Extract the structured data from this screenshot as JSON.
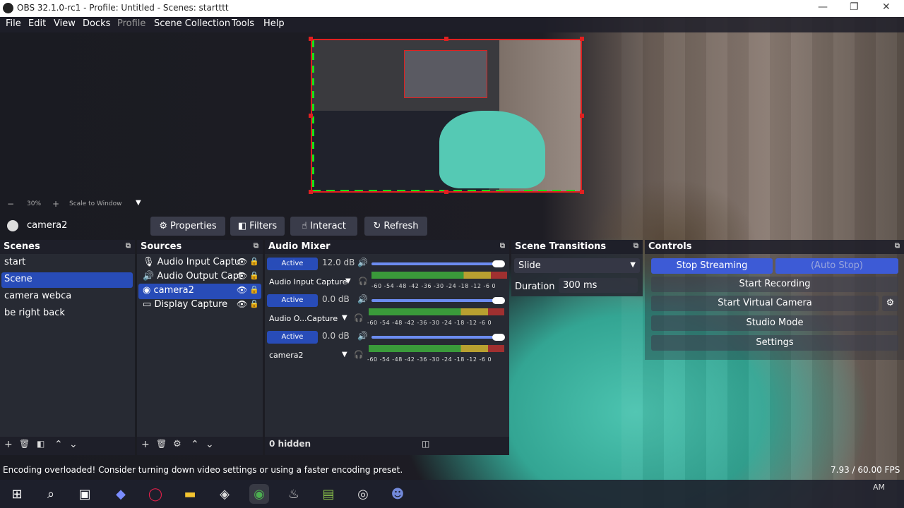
{
  "window": {
    "title": "OBS 32.1.0-rc1 - Profile: Untitled - Scenes: startttt",
    "minimize": "—",
    "maximize": "❐",
    "close": "✕"
  },
  "menu": [
    "File",
    "Edit",
    "View",
    "Docks",
    "Profile",
    "Scene Collection",
    "Tools",
    "Help"
  ],
  "preview": {
    "zoom": "30%",
    "zoom_minus": "−",
    "zoom_plus": "+",
    "scale_mode": "Scale to Window"
  },
  "source_toolbar": {
    "source_name": "camera2",
    "properties": "Properties",
    "filters": "Filters",
    "interact": "Interact",
    "refresh": "Refresh"
  },
  "scenes": {
    "title": "Scenes",
    "items": [
      "start",
      "Scene",
      "camera webca",
      "be right back"
    ],
    "selected": "Scene"
  },
  "sources": {
    "title": "Sources",
    "items": [
      "Audio Input Captu",
      "Audio Output Capt",
      "camera2",
      "Display Capture"
    ],
    "selected": "camera2"
  },
  "audio_mixer": {
    "title": "Audio Mixer",
    "channels": [
      {
        "name": "Audio Input Capture",
        "status": "Active",
        "db": "12.0 dB",
        "volume": 1.0
      },
      {
        "name": "Audio O...Capture",
        "status": "Active",
        "db": "0.0 dB",
        "volume": 1.0
      },
      {
        "name": "camera2",
        "status": "Active",
        "db": "0.0 dB",
        "volume": 1.0
      }
    ],
    "scale": "-60 -54 -48 -42 -36 -30 -24 -18 -12 -6 0",
    "hidden": "0 hidden"
  },
  "scene_transitions": {
    "title": "Scene Transitions",
    "transition": "Slide",
    "duration_label": "Duration",
    "duration": "300 ms"
  },
  "controls": {
    "title": "Controls",
    "stop_streaming": "Stop Streaming",
    "auto_stop": "(Auto Stop)",
    "start_recording": "Start Recording",
    "start_virtual_camera": "Start Virtual Camera",
    "studio_mode": "Studio Mode",
    "settings": "Settings"
  },
  "status": {
    "message": "Encoding overloaded! Consider turning down video settings or using a faster encoding preset.",
    "fps": "7.93 / 60.00 FPS",
    "clock": "AM"
  },
  "colors": {
    "accent": "#284cb8",
    "record_border": "#e02020",
    "guide": "#19e119"
  }
}
